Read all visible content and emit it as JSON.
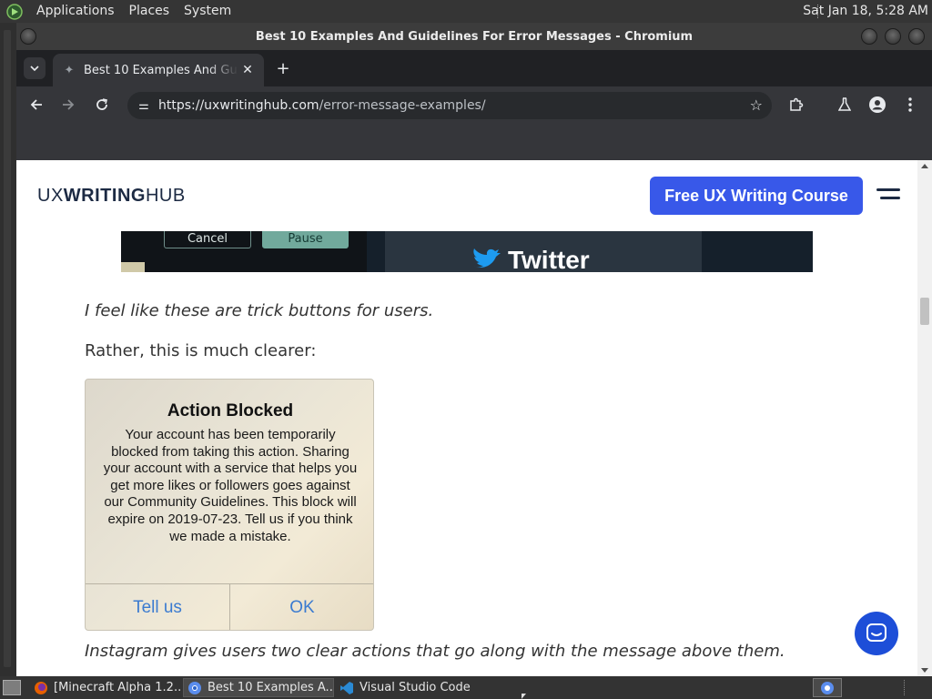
{
  "top_panel": {
    "menus": [
      "Applications",
      "Places",
      "System"
    ],
    "clock": "Sat Jan 18, 5:28 AM"
  },
  "window": {
    "title": "Best 10 Examples And Guidelines For Error Messages - Chromium"
  },
  "browser": {
    "tab_title": "Best 10 Examples And Guidelines For Error Messages",
    "tab_close": "✕",
    "new_tab": "+",
    "url_host": "https://uxwritinghub.com",
    "url_path": "/error-message-examples/"
  },
  "page": {
    "brand_light_1": "UX",
    "brand_bold": "WRITING",
    "brand_light_2": "HUB",
    "cta_label": "Free UX Writing Course",
    "twitter_cancel": "Cancel",
    "twitter_pause": "Pause",
    "twitter_wordmark": "Twitter",
    "para_trick": "I feel like these are trick buttons for users.",
    "para_clearer": "Rather, this is much clearer:",
    "ig_title": "Action Blocked",
    "ig_body": "Your account has been temporarily blocked from taking this action. Sharing your account with a service that helps you get more likes or followers goes against our Community Guidelines. This block will expire on 2019-07-23. Tell us if you think we made a mistake.",
    "ig_btn_left": "Tell us",
    "ig_btn_right": "OK",
    "para_instagram": "Instagram gives users two clear actions that go along with the message above them."
  },
  "taskbar": {
    "tasks": [
      "[Minecraft Alpha 1.2...",
      "Best 10 Examples A...",
      "Visual Studio Code"
    ]
  },
  "colors": {
    "cta": "#3858e9",
    "brand_text": "#1c2a43",
    "ig_button": "#3b7bd0",
    "chat_bubble": "#1d4ed8"
  }
}
